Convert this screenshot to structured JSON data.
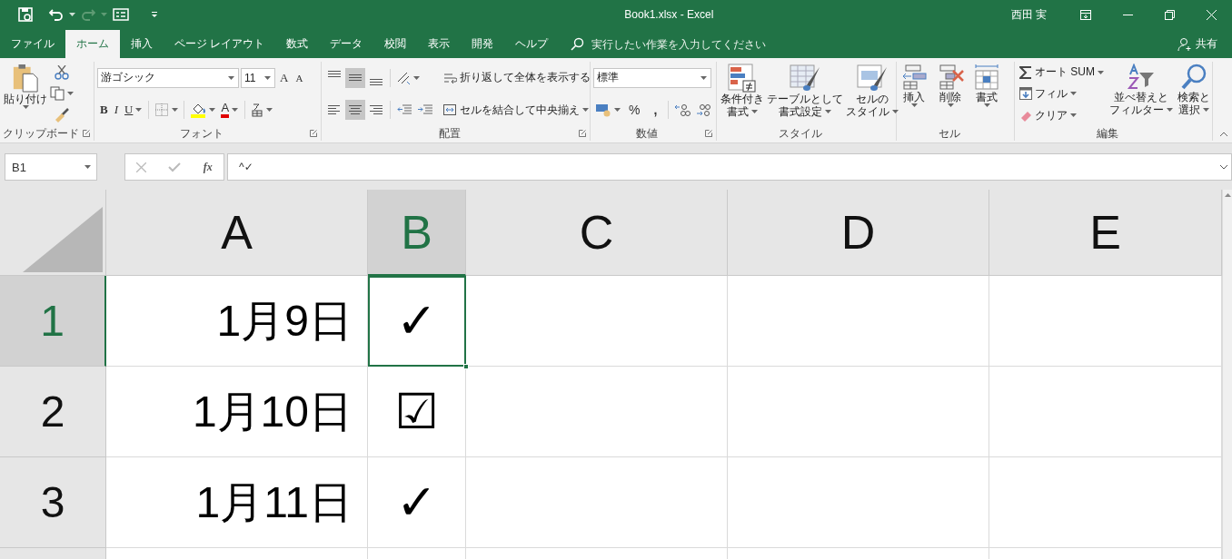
{
  "window": {
    "title": "Book1.xlsx  -  Excel",
    "user": "西田 実"
  },
  "tabs": [
    {
      "label": "ファイル",
      "selected": false
    },
    {
      "label": "ホーム",
      "selected": true
    },
    {
      "label": "挿入",
      "selected": false
    },
    {
      "label": "ページ レイアウト",
      "selected": false
    },
    {
      "label": "数式",
      "selected": false
    },
    {
      "label": "データ",
      "selected": false
    },
    {
      "label": "校閲",
      "selected": false
    },
    {
      "label": "表示",
      "selected": false
    },
    {
      "label": "開発",
      "selected": false
    },
    {
      "label": "ヘルプ",
      "selected": false
    }
  ],
  "tell_me": {
    "placeholder": "実行したい作業を入力してください"
  },
  "share": "共有",
  "ribbon": {
    "clipboard": {
      "label": "クリップボード",
      "paste": "貼り付け"
    },
    "font": {
      "label": "フォント",
      "name": "游ゴシック",
      "size": "11",
      "grow": "A",
      "shrink": "A",
      "bold": "B",
      "italic": "I",
      "underline": "U",
      "font_color": "A"
    },
    "alignment": {
      "label": "配置",
      "vertical": [
        {
          "selected": false
        },
        {
          "selected": true
        },
        {
          "selected": false
        }
      ],
      "horizontal": [
        {
          "selected": false
        },
        {
          "selected": true
        },
        {
          "selected": false
        }
      ],
      "wrap": "折り返して全体を表示する",
      "merge": "セルを結合して中央揃え"
    },
    "number": {
      "label": "数値",
      "format": "標準",
      "percent": "%",
      "comma": ","
    },
    "styles": {
      "label": "スタイル",
      "buttons": [
        [
          "条件付き",
          "書式"
        ],
        [
          "テーブルとして",
          "書式設定"
        ],
        [
          "セルの",
          "スタイル"
        ]
      ]
    },
    "cells": {
      "label": "セル",
      "buttons": [
        "挿入",
        "削除",
        "書式"
      ]
    },
    "editing": {
      "label": "編集",
      "autosum": "オート SUM",
      "fill": "フィル",
      "clear": "クリア",
      "sort": [
        "並べ替えと",
        "フィルター"
      ],
      "find": [
        "検索と",
        "選択"
      ]
    }
  },
  "formula_bar": {
    "name_box": "B1",
    "fx": "fx",
    "value": "^✓"
  },
  "sheet": {
    "columns": [
      {
        "label": "A",
        "selected": false
      },
      {
        "label": "B",
        "selected": true
      },
      {
        "label": "C",
        "selected": false
      },
      {
        "label": "D",
        "selected": false
      },
      {
        "label": "E",
        "selected": false
      }
    ],
    "rows": [
      {
        "label": "1",
        "selected": true,
        "a": "1月9日",
        "b": "✓"
      },
      {
        "label": "2",
        "selected": false,
        "a": "1月10日",
        "b": "☑"
      },
      {
        "label": "3",
        "selected": false,
        "a": "1月11日",
        "b": "✓"
      }
    ]
  }
}
